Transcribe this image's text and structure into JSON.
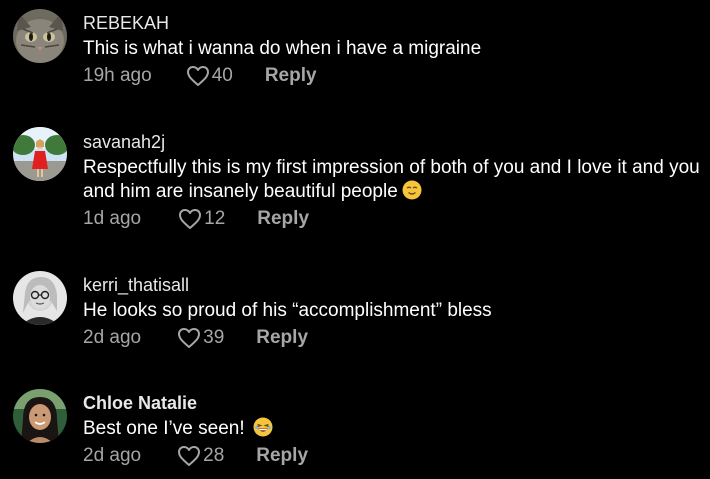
{
  "colors": {
    "background": "#000000",
    "text": "#ffffff",
    "muted": "#a6a6a6"
  },
  "comments": [
    {
      "username": "REBEKAH",
      "text": "This is what i wanna do when i have a migraine",
      "time": "19h ago",
      "likes": "40",
      "reply_label": "Reply",
      "avatar": "cat-avatar"
    },
    {
      "username": "savanah2j",
      "text": "Respectfully this is my first impression of both of you and I love it and you and him are insanely beautiful people",
      "emoji": "relieved-face-emoji",
      "time": "1d ago",
      "likes": "12",
      "reply_label": "Reply",
      "avatar": "woman-red-dress-avatar"
    },
    {
      "username": "kerri_thatisall",
      "text": "He looks so proud of his “accomplishment” bless",
      "time": "2d ago",
      "likes": "39",
      "reply_label": "Reply",
      "avatar": "woman-glasses-avatar"
    },
    {
      "username": "Chloe Natalie",
      "text": "Best one I’ve seen!",
      "emoji": "laughing-face-emoji",
      "time": "2d ago",
      "likes": "28",
      "reply_label": "Reply",
      "avatar": "woman-smiling-avatar"
    }
  ]
}
